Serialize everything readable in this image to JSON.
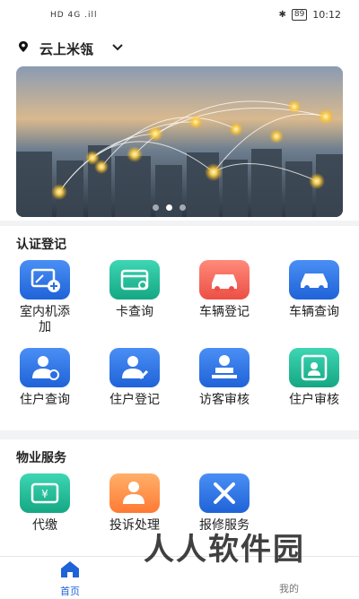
{
  "status_bar": {
    "left_text": "HD 4G .ill",
    "battery": "89",
    "time": "10:12"
  },
  "location": {
    "name": "云上米瓴"
  },
  "banner": {
    "dots": [
      false,
      true,
      false
    ]
  },
  "sections": [
    {
      "title": "认证登记",
      "items": [
        {
          "label": "室内机添加",
          "icon": "indoor-unit-icon",
          "color": "blue"
        },
        {
          "label": "卡查询",
          "icon": "card-search-icon",
          "color": "green"
        },
        {
          "label": "车辆登记",
          "icon": "car-register-icon",
          "color": "red"
        },
        {
          "label": "车辆查询",
          "icon": "car-search-icon",
          "color": "blue"
        },
        {
          "label": "住户查询",
          "icon": "resident-search-icon",
          "color": "blue"
        },
        {
          "label": "住户登记",
          "icon": "resident-register-icon",
          "color": "blue"
        },
        {
          "label": "访客审核",
          "icon": "visitor-review-icon",
          "color": "blue"
        },
        {
          "label": "住户审核",
          "icon": "resident-review-icon",
          "color": "green"
        }
      ]
    },
    {
      "title": "物业服务",
      "items": [
        {
          "label": "代缴",
          "icon": "payment-icon",
          "color": "green"
        },
        {
          "label": "投诉处理",
          "icon": "complaint-icon",
          "color": "orange"
        },
        {
          "label": "报修服务",
          "icon": "repair-icon",
          "color": "blue"
        }
      ]
    }
  ],
  "tabbar": {
    "home_label": "首页",
    "mine_label": "我的"
  },
  "watermark": "人人软件园"
}
